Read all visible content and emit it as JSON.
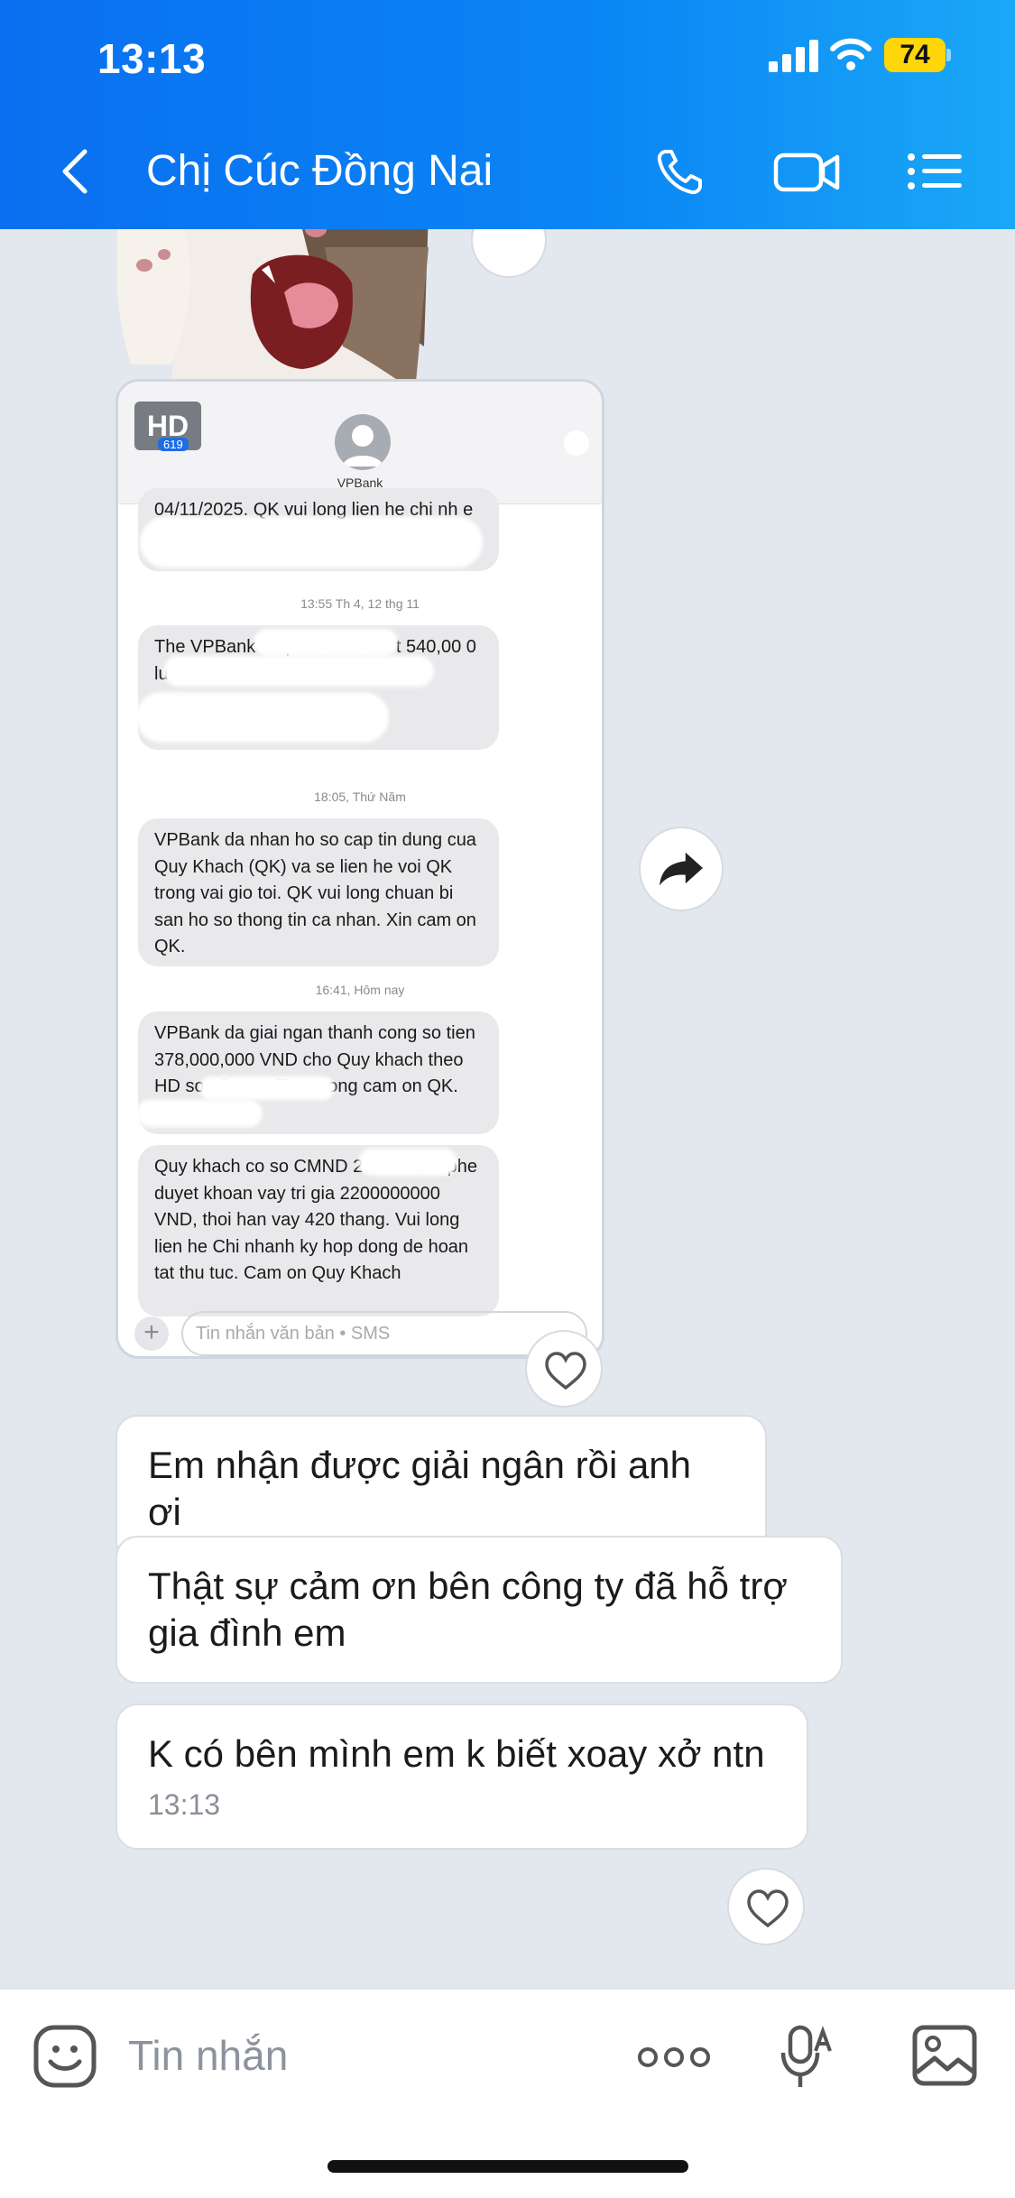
{
  "status_bar": {
    "time": "13:13",
    "battery": "74"
  },
  "header": {
    "title": "Chị Cúc Đồng Nai"
  },
  "shared_screenshot": {
    "badge": "HD",
    "badge_sub": "619",
    "contact": "VPBank",
    "messages": [
      {
        "stamp": "",
        "text": "04/11/2025. QK vui long lien he chi nh                        e"
      },
      {
        "stamp": "13:55 Th 4, 12 thg 11",
        "text": "The VPBank            34 phat sinh GD t                    540,00        0 luc 13:55 12/11 ...                          VND."
      },
      {
        "stamp": "18:05, Thứ Năm",
        "text": "VPBank da nhan ho so cap tin dung cua Quy Khach (QK) va se lien he voi QK trong vai gio toi. QK vui long chuan bi san ho so thong tin ca nhan. Xin cam on QK."
      },
      {
        "stamp": "16:41, Hôm nay",
        "text": "VPBank da giai ngan thanh cong so tien 378,000,000 VND cho Quy khach theo HD so LD              . LH                       Tran trong cam on QK."
      },
      {
        "stamp": "",
        "text": "Quy khach co so CMND               27 da duoc phe duyet khoan vay tri gia 2200000000 VND, thoi han vay 420 thang. Vui long lien he Chi nhanh ky hop dong de hoan tat thu tuc. Cam on Quy Khach"
      }
    ],
    "input_placeholder": "Tin nhắn văn bản • SMS"
  },
  "messages": [
    {
      "text": "Em nhận được giải ngân rồi anh ơi"
    },
    {
      "text": "Thật sự cảm ơn bên công ty đã hỗ trợ gia đình em"
    },
    {
      "text": "K có bên mình em k biết xoay xở ntn",
      "time": "13:13"
    }
  ],
  "composer": {
    "placeholder": "Tin nhắn"
  },
  "colors": {
    "header_start": "#0a6ff0",
    "header_end": "#1aa8f7",
    "chat_bg": "#e3e8ef",
    "battery": "#ffd60a"
  },
  "icons": [
    "signal-icon",
    "wifi-icon",
    "back-arrow-icon",
    "phone-icon",
    "video-icon",
    "list-menu-icon",
    "share-arrow-icon",
    "heart-icon",
    "sticker-icon",
    "more-icon",
    "voice-text-icon",
    "image-icon"
  ]
}
